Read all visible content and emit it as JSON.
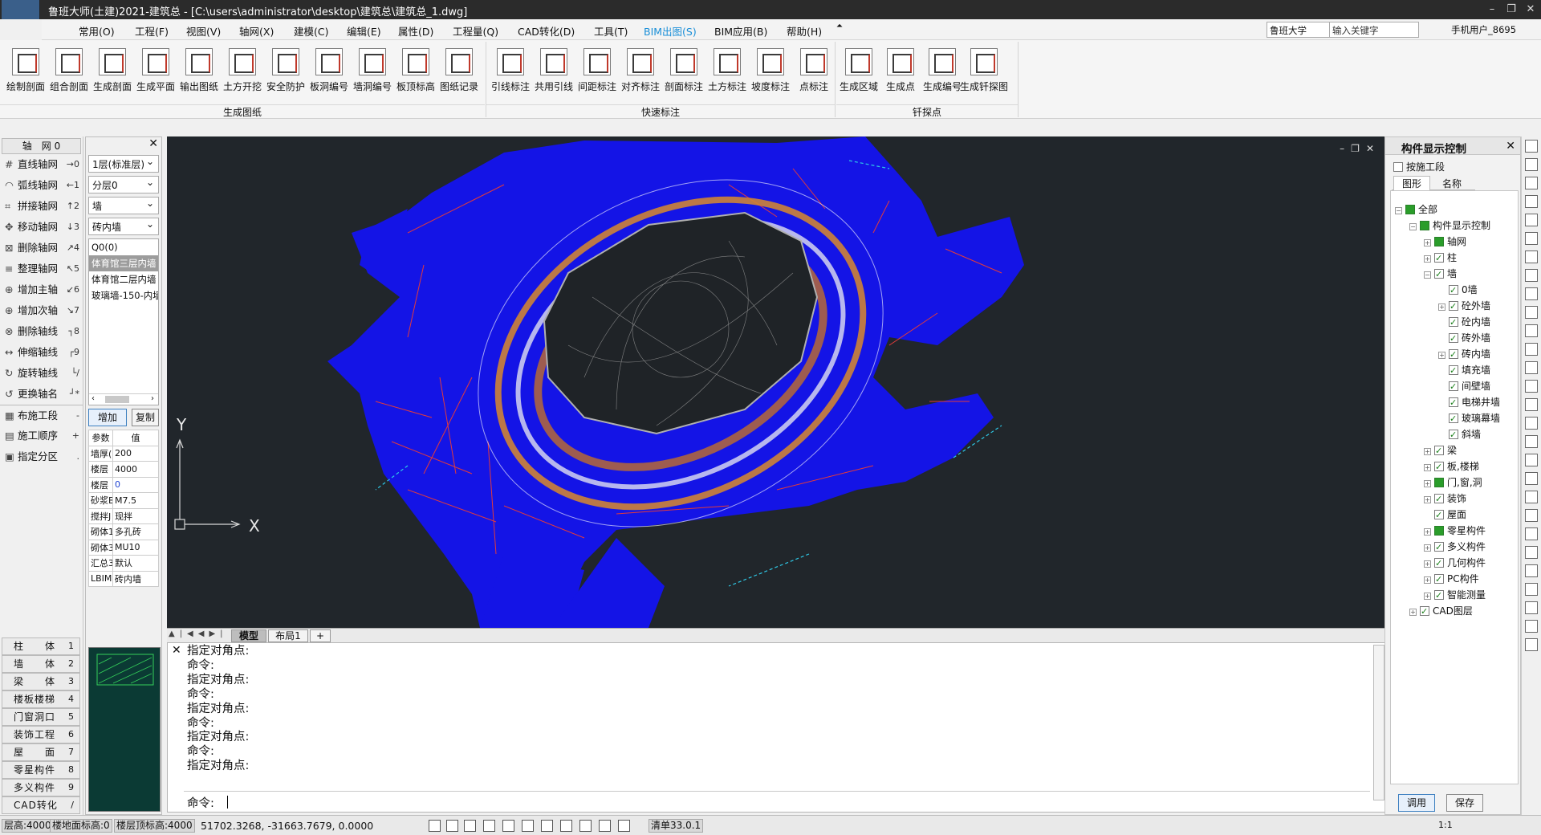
{
  "window": {
    "title": "鲁班大师(土建)2021-建筑总 - [C:\\users\\administrator\\desktop\\建筑总\\建筑总_1.dwg]",
    "minimize": "–",
    "restore": "❐",
    "close": "✕"
  },
  "menu": [
    {
      "label": "常用(O)"
    },
    {
      "label": "工程(F)"
    },
    {
      "label": "视图(V)"
    },
    {
      "label": "轴网(X)"
    },
    {
      "label": "建模(C)"
    },
    {
      "label": "编辑(E)"
    },
    {
      "label": "属性(D)"
    },
    {
      "label": "工程量(Q)"
    },
    {
      "label": "CAD转化(D)"
    },
    {
      "label": "工具(T)"
    },
    {
      "label": "BIM出图(S)",
      "active": true
    },
    {
      "label": "BIM应用(B)"
    },
    {
      "label": "帮助(H)"
    }
  ],
  "search": {
    "scope": "鲁班大学",
    "placeholder": "输入关键字"
  },
  "user": "手机用户_8695",
  "ribbon": {
    "groups": [
      "生成图纸",
      "快速标注",
      "钎探点"
    ],
    "buttons": [
      "绘制剖面",
      "组合剖面",
      "生成剖面",
      "生成平面",
      "输出图纸",
      "土方开挖",
      "安全防护",
      "板洞编号",
      "墙洞编号",
      "板顶标高",
      "图纸记录",
      "引线标注",
      "共用引线",
      "间距标注",
      "对齐标注",
      "剖面标注",
      "土方标注",
      "坡度标注",
      "点标注",
      "生成区域",
      "生成点",
      "生成编号",
      "生成钎探图"
    ]
  },
  "left_panel": {
    "header": "轴　网 0",
    "items": [
      {
        "label": "直线轴网",
        "key": "→0",
        "icon": "grid-icon"
      },
      {
        "label": "弧线轴网",
        "key": "←1",
        "icon": "arc-grid-icon"
      },
      {
        "label": "拼接轴网",
        "key": "↑2",
        "icon": "join-grid-icon"
      },
      {
        "label": "移动轴网",
        "key": "↓3",
        "icon": "move-grid-icon"
      },
      {
        "label": "删除轴网",
        "key": "↗4",
        "icon": "delete-grid-icon"
      },
      {
        "label": "整理轴网",
        "key": "↖5",
        "icon": "tidy-grid-icon"
      },
      {
        "label": "增加主轴",
        "key": "↙6",
        "icon": "add-main-axis-icon"
      },
      {
        "label": "增加次轴",
        "key": "↘7",
        "icon": "add-sub-axis-icon"
      },
      {
        "label": "删除轴线",
        "key": "┐8",
        "icon": "delete-axis-icon"
      },
      {
        "label": "伸缩轴线",
        "key": "┌9",
        "icon": "stretch-axis-icon"
      },
      {
        "label": "旋转轴线",
        "key": "└/",
        "icon": "rotate-axis-icon"
      },
      {
        "label": "更换轴名",
        "key": "┘*",
        "icon": "rename-axis-icon"
      },
      {
        "label": "布施工段",
        "key": "-",
        "icon": "construction-section-icon"
      },
      {
        "label": "施工顺序",
        "key": "+",
        "icon": "construction-order-icon"
      },
      {
        "label": "指定分区",
        "key": ".",
        "icon": "zone-icon"
      }
    ],
    "categories": [
      {
        "label": "柱　　体",
        "num": "1"
      },
      {
        "label": "墙　　体",
        "num": "2"
      },
      {
        "label": "梁　　体",
        "num": "3"
      },
      {
        "label": "楼板楼梯",
        "num": "4"
      },
      {
        "label": "门窗洞口",
        "num": "5"
      },
      {
        "label": "装饰工程",
        "num": "6"
      },
      {
        "label": "屋　　面",
        "num": "7"
      },
      {
        "label": "零星构件",
        "num": "8"
      },
      {
        "label": "多义构件",
        "num": "9"
      },
      {
        "label": "CAD转化",
        "num": "/"
      }
    ]
  },
  "mid_panel": {
    "floor": "1层(标准层)",
    "layer": "分层0",
    "type": "墙",
    "subtype": "砖内墙",
    "components": [
      "Q0(0)",
      "体育馆三层内墙",
      "体育馆二层内墙",
      "玻璃墙-150-内墙"
    ],
    "selected_index": 1,
    "add_label": "增加",
    "copy_label": "复制",
    "param_header": [
      "参数",
      "值"
    ],
    "params": [
      [
        "墙厚(",
        "200"
      ],
      [
        "楼层",
        "4000"
      ],
      [
        "楼层",
        "0"
      ],
      [
        "砂浆B",
        "M7.5"
      ],
      [
        "搅拌J",
        "现拌"
      ],
      [
        "砌体1",
        "多孔砖"
      ],
      [
        "砌体3",
        "MU10"
      ],
      [
        "汇总3",
        "默认"
      ],
      [
        "LBIM",
        "砖内墙"
      ]
    ]
  },
  "canvas": {
    "axis_y": "Y",
    "axis_x": "X",
    "bg_color": "#21262b",
    "fill_color": "#1414e6"
  },
  "tabs": {
    "model": "模型",
    "layout1": "布局1",
    "add": "+"
  },
  "command": {
    "lines": [
      "指定对角点:",
      "命令:",
      "指定对角点:",
      "命令:",
      "指定对角点:",
      "命令:",
      "指定对角点:",
      "命令:",
      "指定对角点:"
    ],
    "prompt": "命令:"
  },
  "right_panel": {
    "title": "构件显示控制",
    "by_section": "按施工段",
    "tab_shape": "图形",
    "tab_name": "名称",
    "tree": [
      {
        "label": "全部",
        "level": 0,
        "exp": "−",
        "cb": "p"
      },
      {
        "label": "构件显示控制",
        "level": 1,
        "exp": "−",
        "cb": "p"
      },
      {
        "label": "轴网",
        "level": 2,
        "exp": "+",
        "cb": "p"
      },
      {
        "label": "柱",
        "level": 2,
        "exp": "+",
        "cb": "c"
      },
      {
        "label": "墙",
        "level": 2,
        "exp": "−",
        "cb": "c"
      },
      {
        "label": "0墙",
        "level": 3,
        "exp": "",
        "cb": "c"
      },
      {
        "label": "砼外墙",
        "level": 3,
        "exp": "+",
        "cb": "c"
      },
      {
        "label": "砼内墙",
        "level": 3,
        "exp": "",
        "cb": "c"
      },
      {
        "label": "砖外墙",
        "level": 3,
        "exp": "",
        "cb": "c"
      },
      {
        "label": "砖内墙",
        "level": 3,
        "exp": "+",
        "cb": "c"
      },
      {
        "label": "填充墙",
        "level": 3,
        "exp": "",
        "cb": "c"
      },
      {
        "label": "间壁墙",
        "level": 3,
        "exp": "",
        "cb": "c"
      },
      {
        "label": "电梯井墙",
        "level": 3,
        "exp": "",
        "cb": "c"
      },
      {
        "label": "玻璃幕墙",
        "level": 3,
        "exp": "",
        "cb": "c"
      },
      {
        "label": "斜墙",
        "level": 3,
        "exp": "",
        "cb": "c"
      },
      {
        "label": "梁",
        "level": 2,
        "exp": "+",
        "cb": "c"
      },
      {
        "label": "板,楼梯",
        "level": 2,
        "exp": "+",
        "cb": "c"
      },
      {
        "label": "门,窗,洞",
        "level": 2,
        "exp": "+",
        "cb": "p"
      },
      {
        "label": "装饰",
        "level": 2,
        "exp": "+",
        "cb": "c"
      },
      {
        "label": "屋面",
        "level": 2,
        "exp": "",
        "cb": "c"
      },
      {
        "label": "零星构件",
        "level": 2,
        "exp": "+",
        "cb": "p"
      },
      {
        "label": "多义构件",
        "level": 2,
        "exp": "+",
        "cb": "c"
      },
      {
        "label": "几何构件",
        "level": 2,
        "exp": "+",
        "cb": "c"
      },
      {
        "label": "PC构件",
        "level": 2,
        "exp": "+",
        "cb": "c"
      },
      {
        "label": "智能测量",
        "level": 2,
        "exp": "+",
        "cb": "c"
      },
      {
        "label": "CAD图层",
        "level": 1,
        "exp": "+",
        "cb": "c"
      }
    ],
    "apply_label": "调用",
    "save_label": "保存"
  },
  "status": {
    "floor_height": "层高:4000",
    "floor_ground": "楼地面标高:0",
    "floor_top": "楼层顶标高:4000",
    "coords": "51702.3268, -31663.7679, 0.0000",
    "list": "清单33.0.1",
    "scale": "1:1"
  }
}
